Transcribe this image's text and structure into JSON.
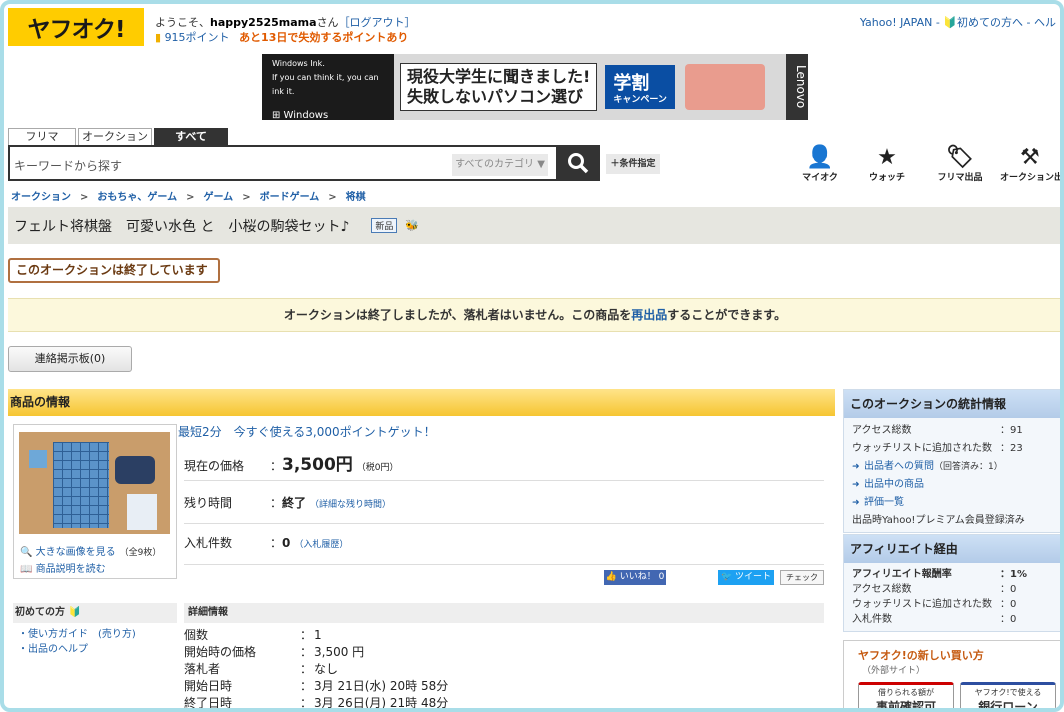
{
  "header": {
    "logo": "ヤフオク!",
    "welcome_prefix": "ようこそ、",
    "username": "happy2525mama",
    "welcome_suffix": "さん",
    "logout": "［ログアウト］",
    "points": "915ポイント",
    "points_expire": "あと13日で失効するポイントあり",
    "top_links": "Yahoo! JAPAN - 🔰初めての方へ - ヘル"
  },
  "banner": {
    "win_line1": "Windows Ink.",
    "win_line2": "If you can think it, you can ink it.",
    "win_logo": "⊞ Windows",
    "headline1": "現役大学生に聞きました!",
    "headline2": "失敗しないパソコン選び",
    "campaign": "学割",
    "campaign_sub": "キャンペーン",
    "brand": "Lenovo"
  },
  "search": {
    "tabs": [
      "フリマ",
      "オークション",
      "すべて"
    ],
    "placeholder": "キーワードから探す",
    "category": "すべてのカテゴリ ▼",
    "button_icon": "search-icon",
    "conditions": "＋条件指定"
  },
  "nav_icons": [
    {
      "label": "マイオク",
      "icon": "person-icon",
      "glyph": "👤"
    },
    {
      "label": "ウォッチ",
      "icon": "star-icon",
      "glyph": "★"
    },
    {
      "label": "フリマ出品",
      "icon": "tag-icon",
      "glyph": "🏷"
    },
    {
      "label": "オークション出品",
      "icon": "gavel-icon",
      "glyph": "⚒"
    }
  ],
  "breadcrumb": [
    "オークション",
    "おもちゃ、ゲーム",
    "ゲーム",
    "ボードゲーム",
    "将棋"
  ],
  "breadcrumb_sep": ">",
  "item": {
    "title": "フェルト将棋盤　可愛い水色 と　小桜の駒袋セット♪",
    "new_badge": "新品",
    "ended_label": "このオークションは終了しています",
    "notice_pre": "オークションは終了しましたが、落札者はいません。この商品を",
    "notice_link": "再出品",
    "notice_post": "することができます。",
    "board_button": "連絡掲示板(0)",
    "info_header": "商品の情報",
    "enlarge_link": "大きな画像を見る",
    "image_count": "（全9枚）",
    "desc_link": "商品説明を読む",
    "promo": "最短2分　今すぐ使える3,000ポイントゲット！",
    "price_label": "現在の価格",
    "colon": "：",
    "price": "3,500円",
    "price_tax": "（税0円）",
    "time_label": "残り時間",
    "time_value": "終了",
    "time_detail": "（詳細な残り時間）",
    "bids_label": "入札件数",
    "bids_value": "0",
    "bids_history": "（入札履歴）",
    "like": "👍 いいね！ 0",
    "tweet": "🐦 ツイート",
    "check": "チェック"
  },
  "first_time": {
    "header": "初めての方 🔰",
    "links": [
      "・使い方ガイド　(売り方)",
      "・出品のヘルプ"
    ]
  },
  "details": {
    "header": "詳細情報",
    "rows": [
      {
        "k": "個数",
        "v": "1"
      },
      {
        "k": "開始時の価格",
        "v": "3,500 円"
      },
      {
        "k": "落札者",
        "v": "なし"
      },
      {
        "k": "開始日時",
        "v": "3月 21日(水) 20時 58分"
      },
      {
        "k": "終了日時",
        "v": "3月 26日(月) 21時 48分"
      }
    ]
  },
  "stats": {
    "header": "このオークションの統計情報",
    "access_label": "アクセス総数",
    "access": "91",
    "watch_label": "ウォッチリストに追加された数",
    "watch": "23",
    "question_link": "出品者への質問",
    "question_count": "（回答済み：1）",
    "selling_link": "出品中の商品",
    "rating_link": "評価一覧",
    "premium": "出品時Yahoo!プレミアム会員登録済み"
  },
  "affiliate": {
    "header": "アフィリエイト経由",
    "rate_label": "アフィリエイト報酬率",
    "rate": "1%",
    "access_label": "アクセス総数",
    "access": "0",
    "watch_label": "ウォッチリストに追加された数",
    "watch": "0",
    "bids_label": "入札件数",
    "bids": "0"
  },
  "howto": {
    "header": "ヤフオク!の新しい買い方",
    "sub": "（外部サイト）",
    "btn1_small": "借りられる額が",
    "btn1": "事前確認可",
    "btn2_small": "ヤフオク!で使える",
    "btn2": "銀行ローン"
  }
}
